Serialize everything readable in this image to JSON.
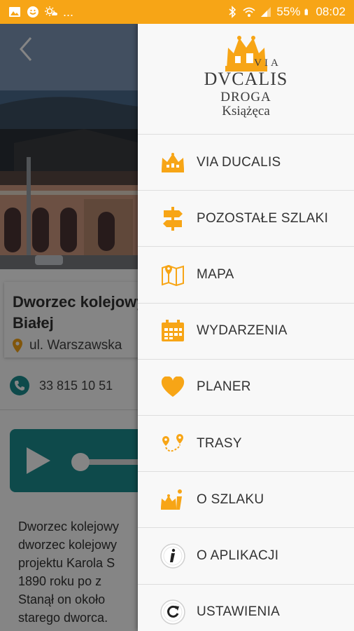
{
  "status_bar": {
    "dots": "...",
    "battery": "55%",
    "time": "08:02"
  },
  "colors": {
    "accent": "#f7a516",
    "teal": "#1b8f91"
  },
  "detail": {
    "title_line1": "Dworzec kolejowy",
    "title_line2": "Białej",
    "address": "ul. Warszawska",
    "phone": "33 815 10 51",
    "description_lines": [
      "Dworzec kolejowy",
      "dworzec kolejowy",
      "projektu Karola S",
      "1890 roku po z",
      "Stanął on około",
      "starego dworca."
    ]
  },
  "logo": {
    "via": "VIA",
    "ducalis": "DVCALIS",
    "droga": "DROGA",
    "ksiazeca": "Książęca"
  },
  "menu": [
    {
      "label": "VIA DUCALIS",
      "icon": "crown-icon"
    },
    {
      "label": "POZOSTAŁE SZLAKI",
      "icon": "signpost-icon"
    },
    {
      "label": "MAPA",
      "icon": "map-icon"
    },
    {
      "label": "WYDARZENIA",
      "icon": "calendar-icon"
    },
    {
      "label": "PLANER",
      "icon": "heart-icon"
    },
    {
      "label": "TRASY",
      "icon": "route-icon"
    },
    {
      "label": "O SZLAKU",
      "icon": "crown-info-icon"
    },
    {
      "label": "O APLIKACJI",
      "icon": "info-icon"
    },
    {
      "label": "USTAWIENIA",
      "icon": "refresh-icon"
    }
  ]
}
